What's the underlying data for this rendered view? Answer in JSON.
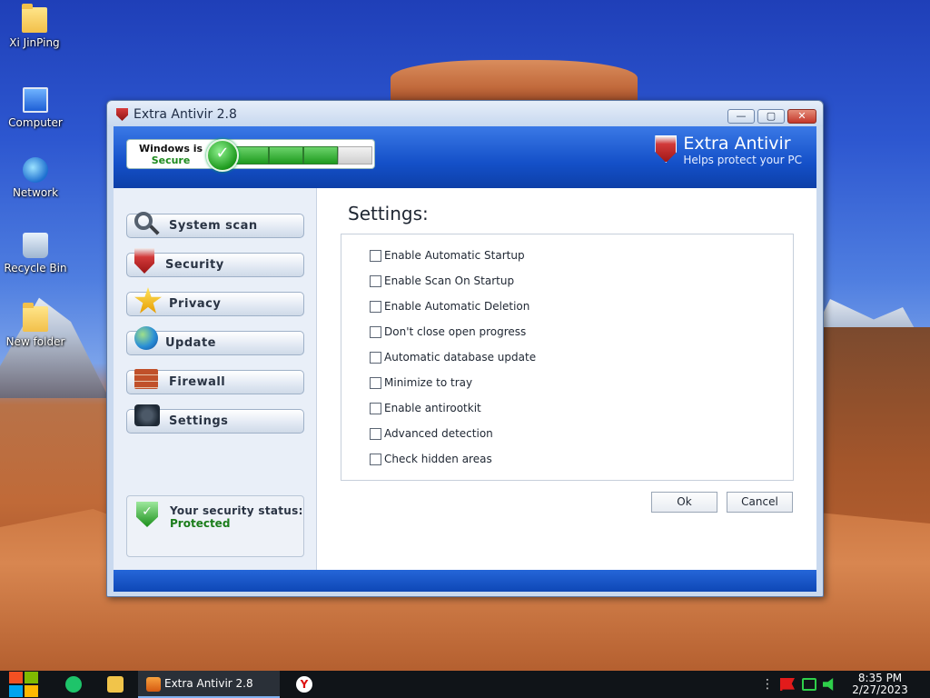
{
  "desktop": {
    "icons": [
      {
        "label": "Xi JinPing"
      },
      {
        "label": "Computer"
      },
      {
        "label": "Network"
      },
      {
        "label": "Recycle Bin"
      },
      {
        "label": "New folder"
      }
    ]
  },
  "window": {
    "title": "Extra Antivir 2.8",
    "header": {
      "status_line1": "Windows is",
      "status_line2": "Secure",
      "brand_name": "Extra Antivir",
      "brand_tagline": "Helps protect your PC"
    },
    "sidebar": {
      "items": [
        {
          "label": "System scan",
          "icon": "magnifier-icon"
        },
        {
          "label": "Security",
          "icon": "shield-icon"
        },
        {
          "label": "Privacy",
          "icon": "star-icon"
        },
        {
          "label": "Update",
          "icon": "globe-icon"
        },
        {
          "label": "Firewall",
          "icon": "firewall-icon"
        },
        {
          "label": "Settings",
          "icon": "settings-icon"
        }
      ],
      "security_status_label": "Your security status:",
      "security_status_value": "Protected"
    },
    "settings": {
      "title": "Settings:",
      "options": [
        {
          "label": "Enable Automatic Startup",
          "checked": false
        },
        {
          "label": "Enable Scan On Startup",
          "checked": false
        },
        {
          "label": "Enable Automatic Deletion",
          "checked": false
        },
        {
          "label": "Don't close open progress",
          "checked": false
        },
        {
          "label": "Automatic database update",
          "checked": false
        },
        {
          "label": "Minimize to tray",
          "checked": false
        },
        {
          "label": "Enable antirootkit",
          "checked": false
        },
        {
          "label": "Advanced detection",
          "checked": false
        },
        {
          "label": "Check hidden areas",
          "checked": false
        }
      ],
      "ok_label": "Ok",
      "cancel_label": "Cancel"
    }
  },
  "taskbar": {
    "active_task": "Extra Antivir 2.8",
    "time": "8:35 PM",
    "date": "2/27/2023"
  },
  "colors": {
    "header_blue": "#1450c8",
    "secure_green": "#1c8a1c"
  }
}
